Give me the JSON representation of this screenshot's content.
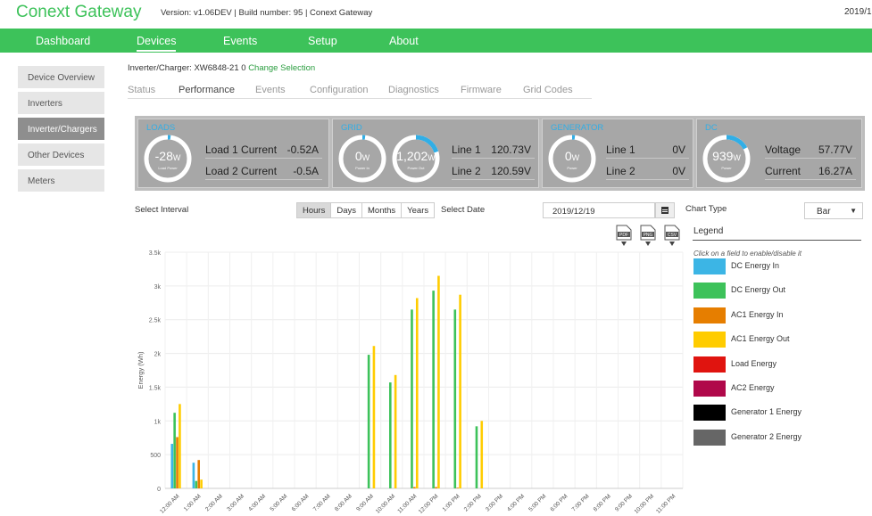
{
  "header": {
    "brand": "Conext Gateway",
    "version": "Version: v1.06DEV | Build number: 95 | Conext Gateway",
    "date": "2019/1"
  },
  "nav": [
    "Dashboard",
    "Devices",
    "Events",
    "Setup",
    "About"
  ],
  "nav_active": "Devices",
  "sidebar": {
    "items": [
      "Device Overview",
      "Inverters",
      "Inverter/Chargers",
      "Other Devices",
      "Meters"
    ],
    "active": "Inverter/Chargers"
  },
  "device": {
    "label": "Inverter/Charger: XW6848-21 0",
    "change_link": "Change Selection"
  },
  "tabs": [
    "Status",
    "Performance",
    "Events",
    "Configuration",
    "Diagnostics",
    "Firmware",
    "Grid Codes"
  ],
  "tabs_active": "Performance",
  "summary": {
    "loads": {
      "title": "LOADS",
      "gauge": {
        "value": "-28",
        "unit": "W",
        "caption": "Load Power",
        "level": 0.02
      },
      "rows": [
        {
          "label": "Load 1 Current",
          "value": "-0.52A"
        },
        {
          "label": "Load 2 Current",
          "value": "-0.5A"
        }
      ]
    },
    "grid": {
      "title": "GRID",
      "gauges": [
        {
          "value": "0",
          "unit": "W",
          "caption": "Power In",
          "level": 0.02
        },
        {
          "value": "1,202",
          "unit": "W",
          "caption": "Power Out",
          "level": 0.2
        }
      ],
      "rows": [
        {
          "label": "Line 1",
          "value": "120.73V"
        },
        {
          "label": "Line 2",
          "value": "120.59V"
        }
      ]
    },
    "generator": {
      "title": "GENERATOR",
      "gauge": {
        "value": "0",
        "unit": "W",
        "caption": "Power",
        "level": 0.02
      },
      "rows": [
        {
          "label": "Line 1",
          "value": "0V"
        },
        {
          "label": "Line 2",
          "value": "0V"
        }
      ]
    },
    "dc": {
      "title": "DC",
      "gauge": {
        "value": "939",
        "unit": "W",
        "caption": "Power",
        "level": 0.17
      },
      "rows": [
        {
          "label": "Voltage",
          "value": "57.77V"
        },
        {
          "label": "Current",
          "value": "16.27A"
        }
      ]
    },
    "gauge_color": "#31aee6"
  },
  "controls": {
    "interval_label": "Select Interval",
    "intervals": [
      "Hours",
      "Days",
      "Months",
      "Years"
    ],
    "interval_active": "Hours",
    "date_label": "Select Date",
    "date_value": "2019/12/19",
    "chart_type_label": "Chart Type",
    "chart_type_value": "Bar",
    "downloads": [
      "PDF",
      "PNG",
      "CSV"
    ]
  },
  "legend": {
    "title": "Legend",
    "hint": "Click on a field to enable/disable it"
  },
  "chart_data": {
    "type": "bar",
    "ylabel": "Energy (Wh)",
    "xlabel": "",
    "ylim": [
      0,
      3500
    ],
    "yticks": [
      0,
      500,
      1000,
      1500,
      2000,
      2500,
      3000,
      3500
    ],
    "ytick_labels": [
      "0",
      "500",
      "1k",
      "1.5k",
      "2k",
      "2.5k",
      "3k",
      "3.5k"
    ],
    "grid": true,
    "categories": [
      "12:00 AM",
      "1:00 AM",
      "2:00 AM",
      "3:00 AM",
      "4:00 AM",
      "5:00 AM",
      "6:00 AM",
      "7:00 AM",
      "8:00 AM",
      "9:00 AM",
      "10:00 AM",
      "11:00 AM",
      "12:00 PM",
      "1:00 PM",
      "2:00 PM",
      "3:00 PM",
      "4:00 PM",
      "5:00 PM",
      "6:00 PM",
      "7:00 PM",
      "8:00 PM",
      "9:00 PM",
      "10:00 PM",
      "11:00 PM"
    ],
    "series": [
      {
        "name": "DC Energy In",
        "color": "#3cb5e5",
        "values": [
          660,
          380,
          0,
          0,
          0,
          0,
          0,
          0,
          0,
          0,
          0,
          0,
          0,
          0,
          0,
          0,
          0,
          0,
          0,
          0,
          0,
          0,
          0,
          0
        ]
      },
      {
        "name": "DC Energy Out",
        "color": "#3dc25a",
        "values": [
          1120,
          110,
          0,
          0,
          0,
          0,
          0,
          0,
          0,
          1980,
          1570,
          2650,
          2930,
          2650,
          920,
          0,
          0,
          0,
          0,
          0,
          0,
          0,
          0,
          0
        ]
      },
      {
        "name": "AC1 Energy In",
        "color": "#e67e00",
        "values": [
          760,
          420,
          0,
          0,
          0,
          0,
          0,
          0,
          0,
          0,
          0,
          20,
          20,
          10,
          0,
          0,
          0,
          0,
          0,
          0,
          0,
          0,
          0,
          0
        ]
      },
      {
        "name": "AC1 Energy Out",
        "color": "#ffcc00",
        "values": [
          1250,
          130,
          0,
          0,
          0,
          0,
          0,
          0,
          0,
          2110,
          1680,
          2820,
          3150,
          2870,
          1000,
          0,
          0,
          0,
          0,
          0,
          0,
          0,
          0,
          0
        ]
      },
      {
        "name": "Load Energy",
        "color": "#e0140f",
        "values": [
          0,
          0,
          0,
          0,
          0,
          0,
          0,
          0,
          0,
          0,
          0,
          0,
          0,
          0,
          0,
          0,
          0,
          0,
          0,
          0,
          0,
          0,
          0,
          0
        ]
      },
      {
        "name": "AC2 Energy",
        "color": "#b0084a",
        "values": [
          0,
          0,
          0,
          0,
          0,
          0,
          0,
          0,
          0,
          0,
          0,
          0,
          0,
          0,
          0,
          0,
          0,
          0,
          0,
          0,
          0,
          0,
          0,
          0
        ]
      },
      {
        "name": "Generator 1 Energy",
        "color": "#000000",
        "values": [
          0,
          0,
          0,
          0,
          0,
          0,
          0,
          0,
          0,
          0,
          0,
          0,
          0,
          0,
          0,
          0,
          0,
          0,
          0,
          0,
          0,
          0,
          0,
          0
        ]
      },
      {
        "name": "Generator 2 Energy",
        "color": "#666666",
        "values": [
          0,
          0,
          0,
          0,
          0,
          0,
          0,
          0,
          0,
          0,
          0,
          0,
          0,
          0,
          0,
          0,
          0,
          0,
          0,
          0,
          0,
          0,
          0,
          0
        ]
      }
    ]
  }
}
